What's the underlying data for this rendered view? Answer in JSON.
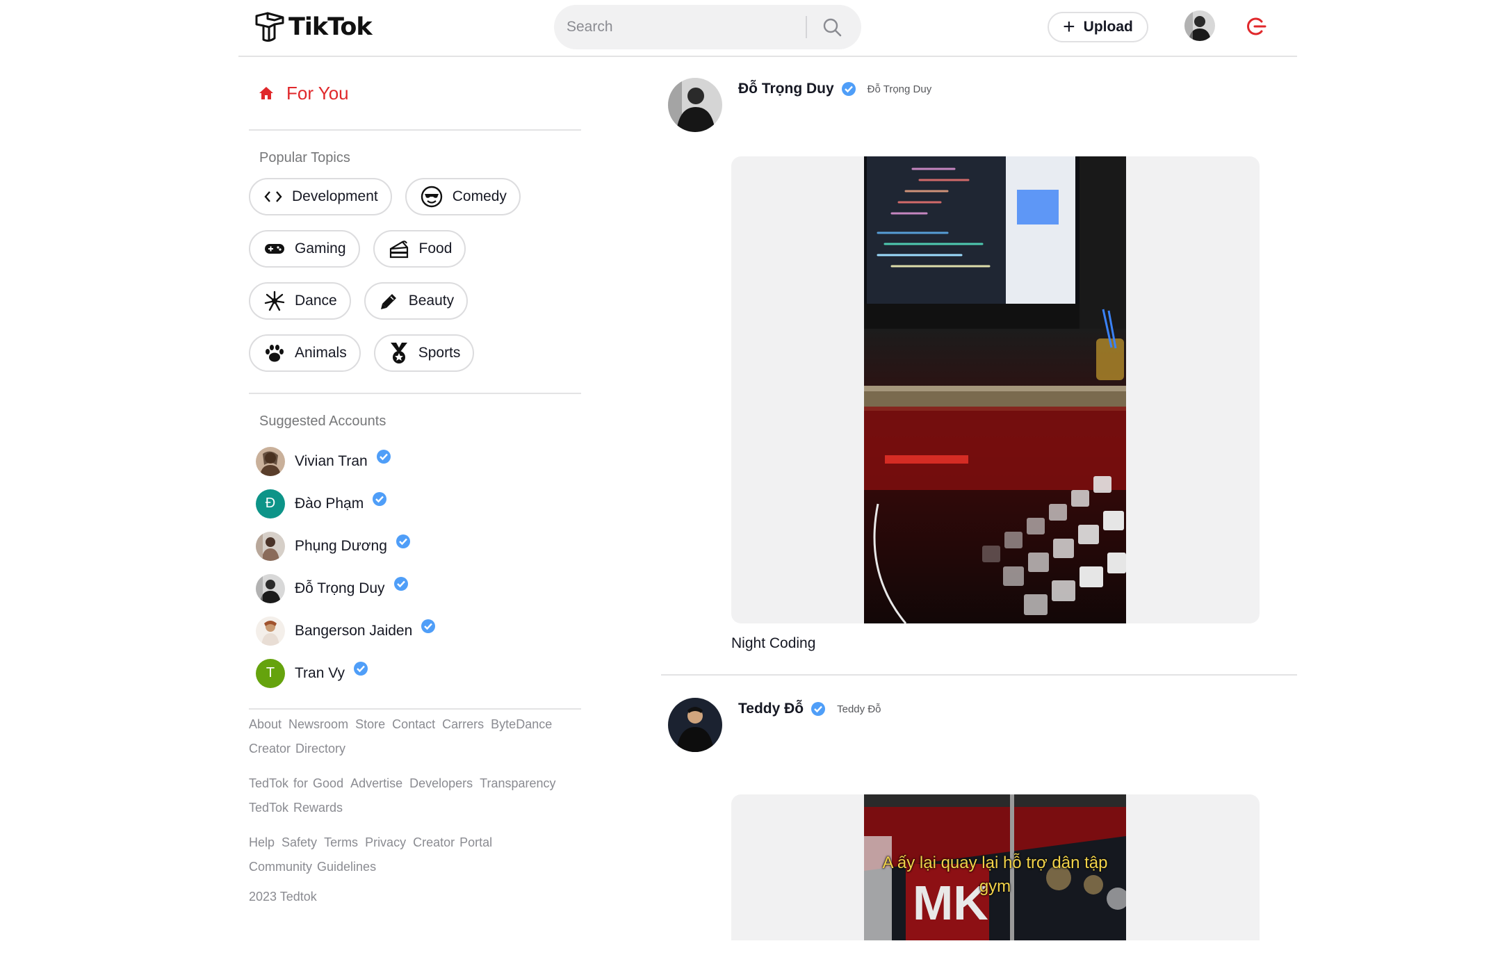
{
  "header": {
    "logo_text": "TikTok",
    "search_placeholder": "Search",
    "upload_label": "Upload",
    "brand_color": "#e0282b"
  },
  "sidebar": {
    "for_you_label": "For You",
    "popular_topics_title": "Popular Topics",
    "topics": [
      {
        "label": "Development",
        "icon": "code-icon"
      },
      {
        "label": "Comedy",
        "icon": "sunglasses-face-icon"
      },
      {
        "label": "Gaming",
        "icon": "gamepad-icon"
      },
      {
        "label": "Food",
        "icon": "cake-icon"
      },
      {
        "label": "Dance",
        "icon": "dance-icon"
      },
      {
        "label": "Beauty",
        "icon": "brush-icon"
      },
      {
        "label": "Animals",
        "icon": "paw-icon"
      },
      {
        "label": "Sports",
        "icon": "medal-icon"
      }
    ],
    "suggested_title": "Suggested Accounts",
    "accounts": [
      {
        "name": "Vivian Tran",
        "avatar_color": "#8a6a4e"
      },
      {
        "name": "Đào Phạm",
        "initial": "Đ",
        "avatar_color": "#0d9488"
      },
      {
        "name": "Phụng Dương",
        "avatar_color": "#9b8576"
      },
      {
        "name": "Đỗ Trọng Duy",
        "avatar_color": "#4a4a4a"
      },
      {
        "name": "Bangerson Jaiden",
        "avatar_color": "#d9c6b8"
      },
      {
        "name": "Tran Vy",
        "initial": "T",
        "avatar_color": "#65a30d"
      }
    ],
    "footer": {
      "group1": [
        "About",
        "Newsroom",
        "Store",
        "Contact",
        "Carrers",
        "ByteDance",
        "Creator Directory"
      ],
      "group2": [
        "TedTok for Good",
        "Advertise",
        "Developers",
        "Transparency",
        "TedTok Rewards"
      ],
      "group3": [
        "Help",
        "Safety",
        "Terms",
        "Privacy",
        "Creator Portal",
        "Community Guidelines"
      ],
      "copyright": "2023 Tedtok"
    }
  },
  "feed": {
    "posts": [
      {
        "name": "Đỗ Trọng Duy",
        "handle": "Đỗ Trọng Duy",
        "caption": "Night Coding"
      },
      {
        "name": "Teddy Đỗ",
        "handle": "Teddy Đỗ",
        "overlay_text": "A ấy lại quay lại hỗ trợ dân tập gym"
      }
    ]
  },
  "colors": {
    "accent": "#e0282b",
    "verified": "#20d5ec",
    "verified_blue": "#3b82f6",
    "muted": "#8a8b91"
  }
}
